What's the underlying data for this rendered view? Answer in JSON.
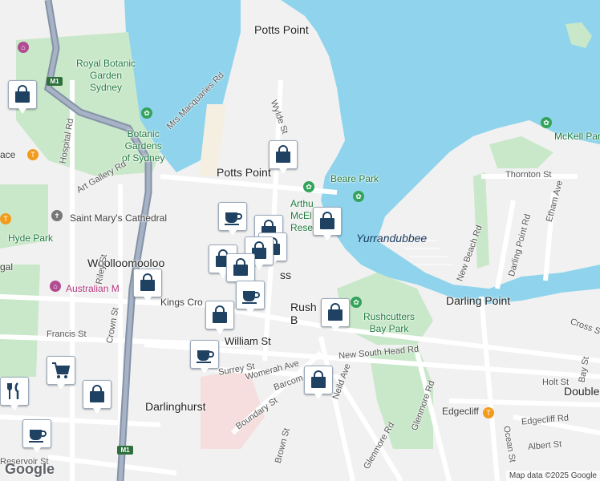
{
  "map": {
    "labels": {
      "potts_point_north": "Potts Point",
      "potts_point": "Potts Point",
      "royal_botanic_garden": "Royal Botanic\nGarden\nSydney",
      "botanic_gardens": "Botanic\nGardens\nof Sydney",
      "mrs_macquaries": "Mrs Macquaries Rd",
      "saint_marys": "Saint Mary's Cathedral",
      "hyde_park": "Hyde Park",
      "woolloomooloo": "Woolloomooloo",
      "australian_museum": "Australian M",
      "kings_cross": "Kings Cro",
      "william_st": "William St",
      "darlinghurst": "Darlinghurst",
      "beare_park": "Beare Park",
      "arthur_mcelhone": "Arthu\nMcEl\nRese",
      "yurrandubbee": "Yurrandubbee",
      "rushcutters_bay": "Rush   ters\nB",
      "rushcutters_bay_park": "Rushcutters\nBay Park",
      "darling_point": "Darling Point",
      "mckell_park": "McKell Park",
      "thornton_st": "Thornton St",
      "new_south_head_rd": "New South Head Rd",
      "edgecliff": "Edgecliff",
      "edgecliff_rd": "Edgecliff Rd",
      "double": "Double",
      "wylde_st": "Wylde St",
      "art_gallery_rd": "Art Gallery Rd",
      "hospital_rd": "Hospital Rd",
      "riley_st": "Riley St",
      "crown_st": "Crown St",
      "francis_st": "Francis St",
      "surrey_st": "Surrey St",
      "womerah_ave": "Womerah Ave",
      "barcom_ave": "Barcom Ave",
      "boundary_st": "Boundary St",
      "nield_ave": "Neild Ave",
      "brown_st": "Brown St",
      "glenmore_rd": "Glenmore Rd",
      "glenmore_rd2": "Glenmore Rd",
      "new_beach_rd": "New Beach Rd",
      "darling_point_rd": "Darling Point Rd",
      "ethan_ave": "Etham Ave",
      "ocean_st": "Ocean St",
      "holt_st": "Holt St",
      "albert_st": "Albert St",
      "cross_st": "Cross St",
      "bay_st": "Bay St",
      "reservoir_st": "Reservoir St",
      "gal": "gal",
      "ace": "ace",
      "m1": "M1",
      "m1b": "M1",
      "ss": "ss"
    },
    "colors": {
      "water": "#8fd4ec",
      "park": "#c9e8c9",
      "land": "#f1f1f1",
      "road": "#ffffff",
      "motorway": "#8392a8",
      "pin_icon": "#1f4262"
    },
    "pins": [
      {
        "name": "shopping-bag-icon"
      },
      {
        "name": "shopping-bag-icon"
      },
      {
        "name": "coffee-cup-icon"
      },
      {
        "name": "shopping-bag-icon"
      },
      {
        "name": "shopping-bag-icon"
      },
      {
        "name": "shopping-bag-icon"
      },
      {
        "name": "shopping-bag-icon"
      },
      {
        "name": "shopping-bag-icon"
      },
      {
        "name": "shopping-bag-icon"
      },
      {
        "name": "coffee-cup-icon"
      },
      {
        "name": "shopping-bag-icon"
      },
      {
        "name": "shopping-bag-icon"
      },
      {
        "name": "coffee-cup-icon"
      },
      {
        "name": "shopping-bag-icon"
      },
      {
        "name": "shopping-cart-icon"
      },
      {
        "name": "shopping-bag-icon"
      },
      {
        "name": "shopping-bag-icon"
      },
      {
        "name": "coffee-cup-icon"
      },
      {
        "name": "restaurant-icon"
      }
    ],
    "logo": "Google",
    "attribution": "Map data ©2025 Google"
  }
}
